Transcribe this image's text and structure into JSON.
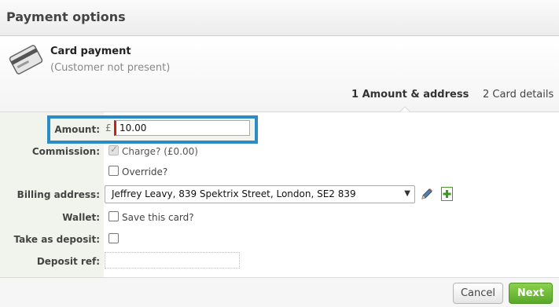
{
  "dialog": {
    "title": "Payment options"
  },
  "header": {
    "card_title": "Card payment",
    "card_subtitle": "(Customer not present)",
    "tabs": [
      {
        "label": "1 Amount & address",
        "active": true
      },
      {
        "label": "2 Card details",
        "active": false
      }
    ]
  },
  "form": {
    "amount": {
      "label": "Amount:",
      "currency": "£",
      "value": "10.00"
    },
    "commission": {
      "label": "Commission:",
      "charge_label": "Charge? (£0.00)",
      "charge_checked": true,
      "charge_disabled": true,
      "override_label": "Override?",
      "override_checked": false
    },
    "billing_address": {
      "label": "Billing address:",
      "selected": "Jeffrey Leavy, 839 Spektrix Street, London, SE2 839",
      "edit_icon": "pencil-icon",
      "add_icon": "plus-icon"
    },
    "wallet": {
      "label": "Wallet:",
      "save_label": "Save this card?",
      "checked": false
    },
    "take_as_deposit": {
      "label": "Take as deposit:",
      "checked": false
    },
    "deposit_ref": {
      "label": "Deposit ref:",
      "value": ""
    }
  },
  "footer": {
    "cancel_label": "Cancel",
    "next_label": "Next"
  },
  "colors": {
    "highlight": "#2b8bc6",
    "primary_button": "#5aa82a",
    "required_marker": "#d21b1b",
    "label_column": "#f1f4ec"
  }
}
